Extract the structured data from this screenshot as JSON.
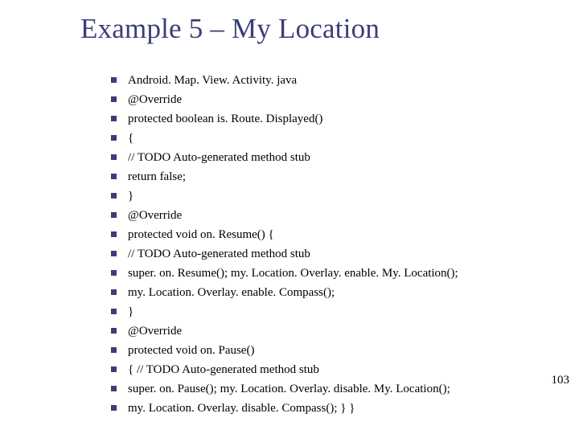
{
  "title": "Example 5 – My Location",
  "lines": [
    "Android. Map. View. Activity. java",
    "@Override",
    "protected boolean is. Route. Displayed()",
    "{",
    "// TODO Auto‐generated method stub",
    "return false;",
    "}",
    "@Override",
    "protected void on. Resume() {",
    "// TODO Auto‐generated method stub",
    "super. on. Resume(); my. Location. Overlay. enable. My. Location();",
    "my. Location. Overlay. enable. Compass();",
    "}",
    "@Override",
    "protected void on. Pause()",
    "{ // TODO Auto‐generated method stub",
    "super. on. Pause(); my. Location. Overlay. disable. My. Location();",
    "my. Location. Overlay. disable. Compass(); }  }"
  ],
  "page_number": "103"
}
